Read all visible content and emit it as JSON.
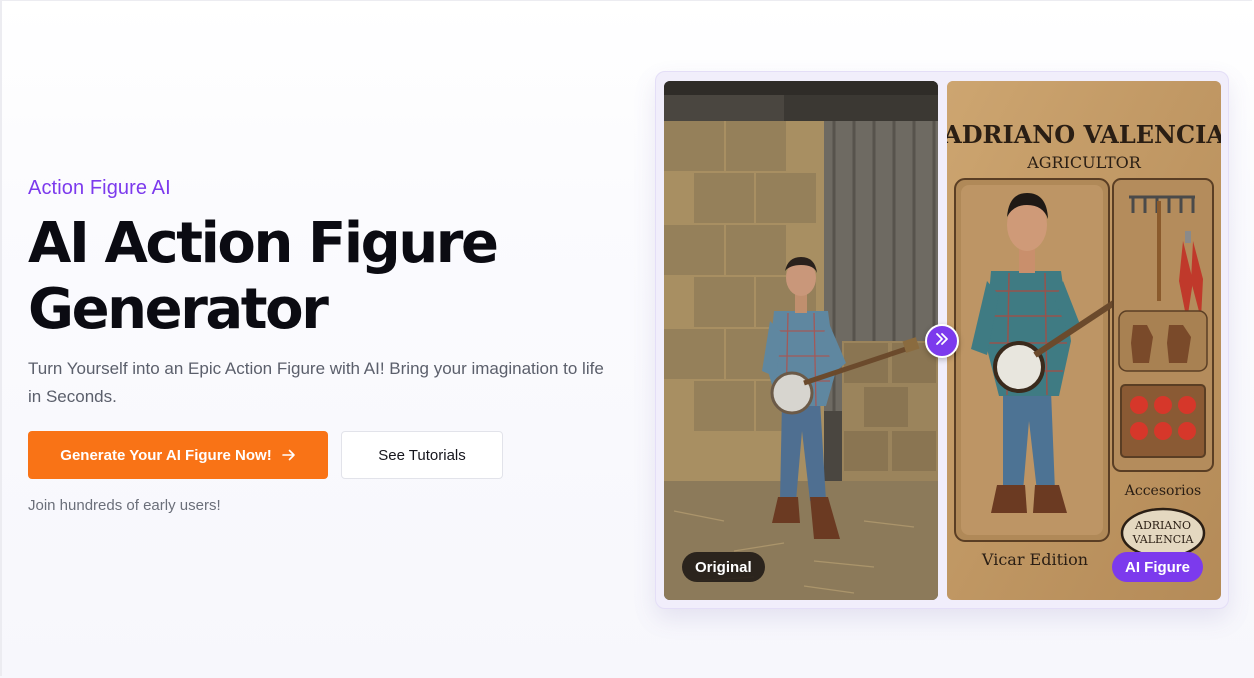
{
  "hero": {
    "eyebrow": "Action Figure AI",
    "title_line1": "AI Action Figure",
    "title_line2": "Generator",
    "subtitle": "Turn Yourself into an Epic Action Figure with AI! Bring your imagination to life in Seconds.",
    "primary_cta": "Generate Your AI Figure Now!",
    "primary_cta_icon": "arrow-right-icon",
    "secondary_cta": "See Tutorials",
    "social_proof": "Join hundreds of early users!"
  },
  "comparison": {
    "before_label": "Original",
    "after_label": "AI Figure",
    "swap_icon": "chevrons-right-icon",
    "box_name": "ADRIANO VALENCIA",
    "box_subtitle": "AGRICULTOR",
    "accessories_label": "Accesorios",
    "badge_line1": "ADRIANO",
    "badge_line2": "VALENCIA",
    "edition": "Vicar Edition"
  },
  "colors": {
    "accent": "#7c3aed",
    "cta": "#f97316",
    "heading": "#0b0b12",
    "body_text": "#5b5f6b"
  }
}
